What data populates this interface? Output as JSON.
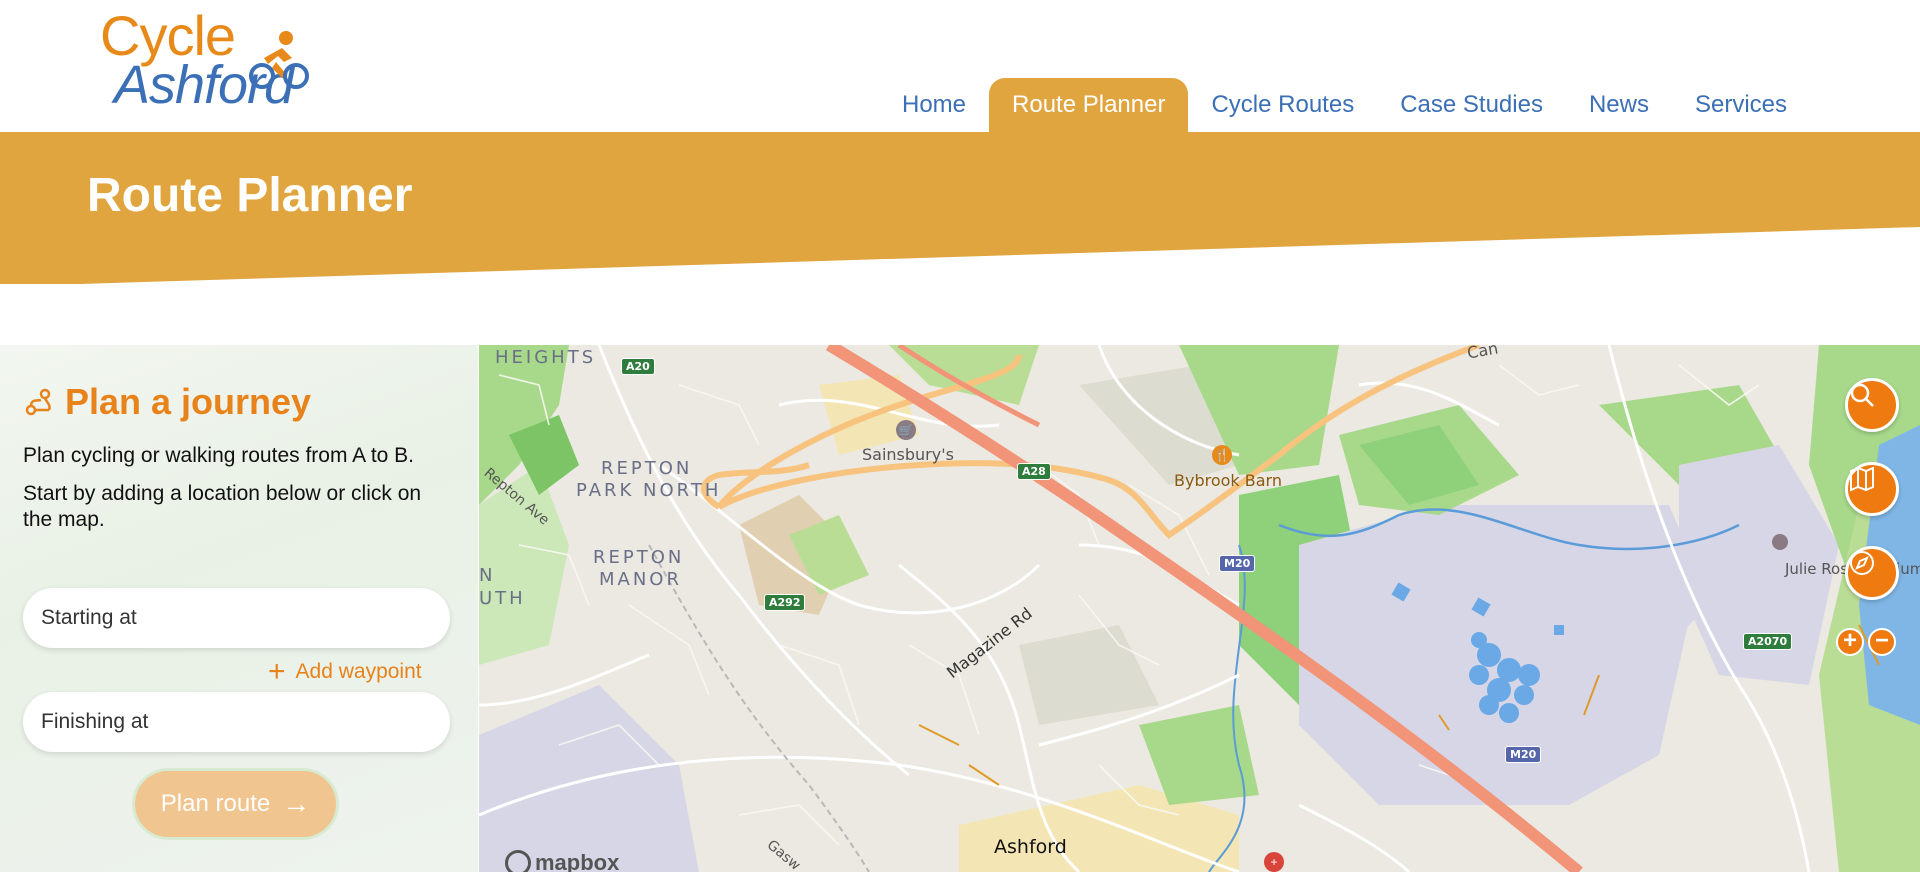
{
  "header": {
    "logo_top": "Cycle",
    "logo_bottom": "Ashford",
    "nav": [
      {
        "label": "Home",
        "active": false
      },
      {
        "label": "Route Planner",
        "active": true
      },
      {
        "label": "Cycle Routes",
        "active": false
      },
      {
        "label": "Case Studies",
        "active": false
      },
      {
        "label": "News",
        "active": false
      },
      {
        "label": "Services",
        "active": false
      }
    ]
  },
  "banner": {
    "title": "Route Planner"
  },
  "planner": {
    "icon": "route-icon",
    "title": "Plan a journey",
    "intro_1": "Plan cycling or walking routes from A to B.",
    "intro_2": "Start by adding a location below or click on the map.",
    "start_placeholder": "Starting at",
    "add_waypoint": "Add waypoint",
    "finish_placeholder": "Finishing at",
    "plan_button": "Plan route"
  },
  "map": {
    "labels": {
      "heights": "HEIGHTS",
      "repton_park_north_1": "REPTON",
      "repton_park_north_2": "PARK NORTH",
      "repton_manor_1": "REPTON",
      "repton_manor_2": "MANOR",
      "n_label": "N",
      "uth_label": "UTH",
      "repton_ave": "Repton Ave",
      "sainsburys": "Sainsbury's",
      "bybrook_barn": "Bybrook Barn",
      "magazine_rd": "Magazine Rd",
      "julie_rose": "Julie Rose Stadium",
      "ashford": "Ashford",
      "cam": "Can",
      "gasworks": "Gasw"
    },
    "roads": {
      "a20": "A20",
      "a28": "A28",
      "a292": "A292",
      "m20_top": "M20",
      "m20_bottom": "M20",
      "a2070": "A2070"
    },
    "attribution": "mapbox",
    "controls": [
      "search-icon",
      "map-layers-icon",
      "compass-icon"
    ],
    "zoom_in": "+",
    "zoom_out": "−"
  },
  "colors": {
    "accent": "#e8821a",
    "banner": "#e1a53f",
    "nav_link": "#3b6fb6"
  }
}
